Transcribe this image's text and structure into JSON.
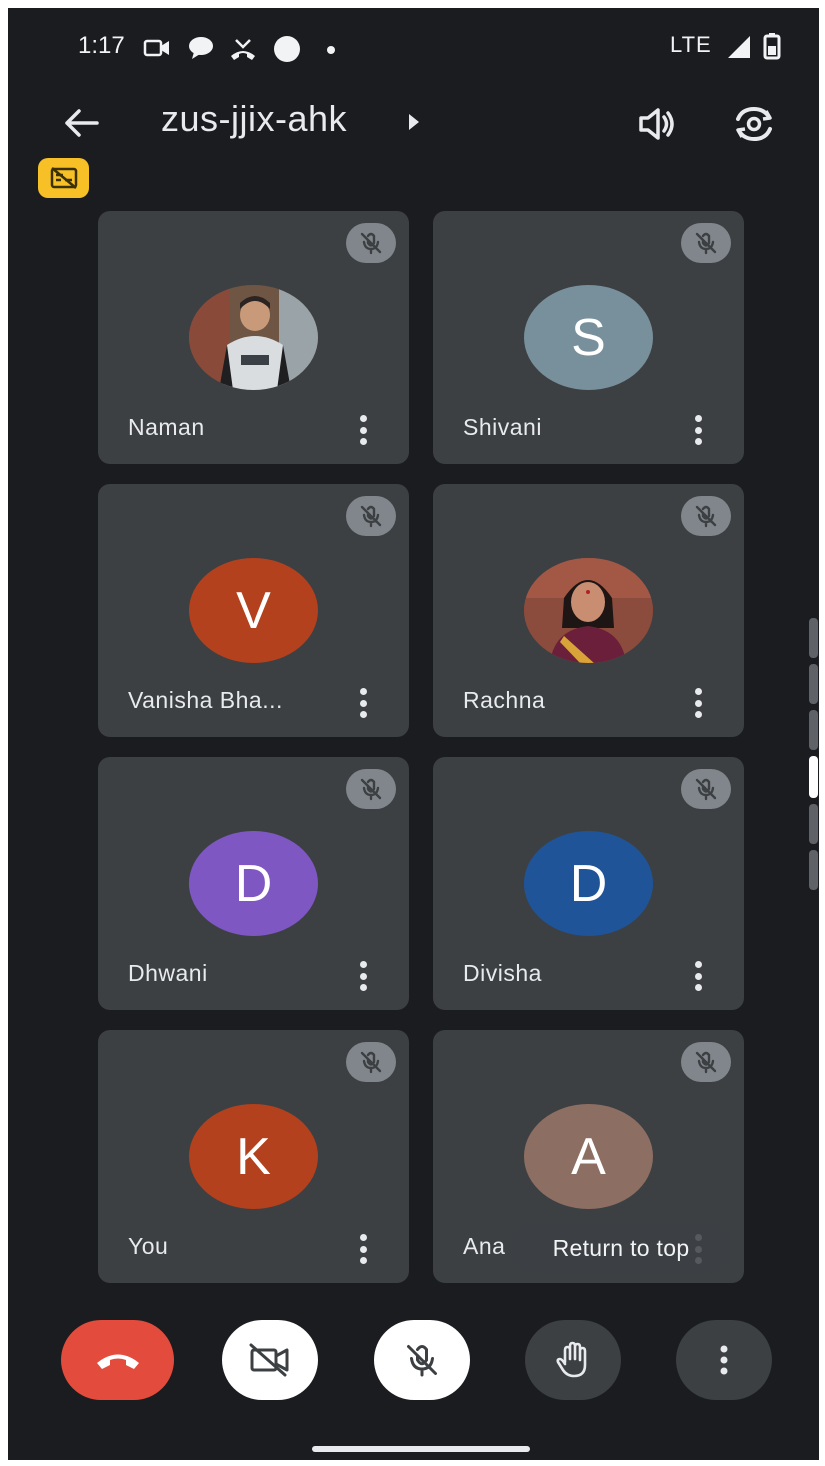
{
  "status_bar": {
    "time": "1:17",
    "network": "LTE",
    "icons": [
      "video-icon",
      "chat-bubble-icon",
      "missed-call-icon",
      "circle-icon",
      "dot-icon",
      "signal-icon",
      "battery-icon"
    ]
  },
  "header": {
    "meeting_code": "zus-jjix-ahk",
    "icons": [
      "back-arrow-icon",
      "caret-right-icon",
      "speaker-icon",
      "switch-camera-icon"
    ]
  },
  "caption_badge_icon": "captions-off-icon",
  "participants": [
    {
      "name": "Naman",
      "avatar_type": "photo",
      "avatar_letter": "",
      "avatar_color": "#5d4b3f",
      "muted": true
    },
    {
      "name": "Shivani",
      "avatar_type": "letter",
      "avatar_letter": "S",
      "avatar_color": "#78909c",
      "muted": true
    },
    {
      "name": "Vanisha Bha...",
      "avatar_type": "letter",
      "avatar_letter": "V",
      "avatar_color": "#b3411d",
      "muted": true
    },
    {
      "name": "Rachna",
      "avatar_type": "photo",
      "avatar_letter": "",
      "avatar_color": "#7a4a3e",
      "muted": true
    },
    {
      "name": "Dhwani",
      "avatar_type": "letter",
      "avatar_letter": "D",
      "avatar_color": "#7e57c2",
      "muted": true
    },
    {
      "name": "Divisha",
      "avatar_type": "letter",
      "avatar_letter": "D",
      "avatar_color": "#1f5499",
      "muted": true
    },
    {
      "name": "You",
      "avatar_type": "letter",
      "avatar_letter": "K",
      "avatar_color": "#b3411d",
      "muted": true
    },
    {
      "name": "Ana",
      "avatar_type": "letter",
      "avatar_letter": "A",
      "avatar_color": "#8d6e63",
      "muted": true
    }
  ],
  "return_to_top_label": "Return to top",
  "controls": {
    "end_call_icon": "hang-up-icon",
    "camera_icon": "camera-off-icon",
    "mic_icon": "mic-off-icon",
    "raise_hand_icon": "raise-hand-icon",
    "more_icon": "more-vert-icon",
    "colors": {
      "end_call": "#e34c3c",
      "toggled_off": "#ffffff",
      "neutral": "#3c4043"
    }
  },
  "page_indicator": {
    "pages": 6,
    "current": 4
  }
}
